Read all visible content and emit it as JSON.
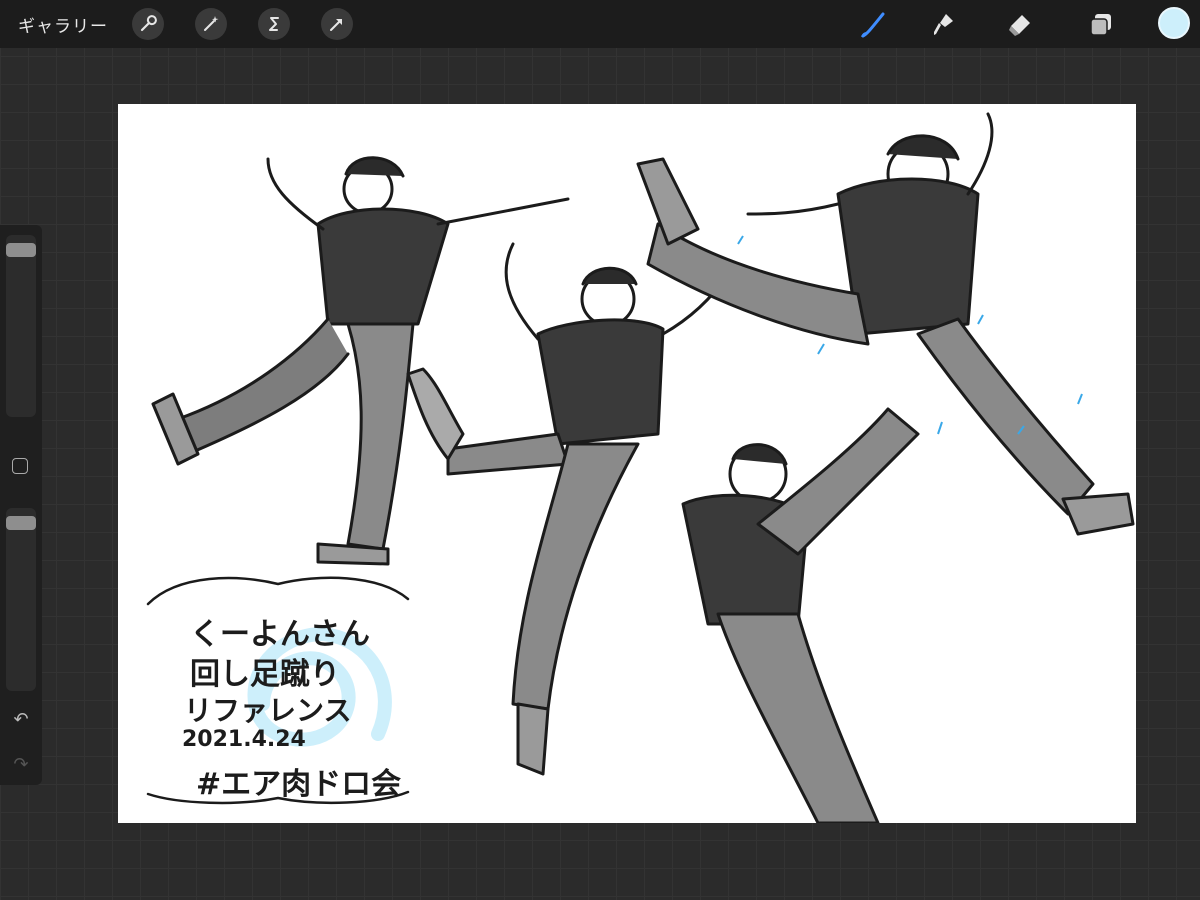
{
  "topbar": {
    "gallery_label": "ギャラリー",
    "tools_left": [
      "wrench-icon",
      "magic-wand-icon",
      "selection-icon",
      "transform-arrow-icon"
    ],
    "tools_right": [
      "brush-icon",
      "smudge-icon",
      "eraser-icon",
      "layers-icon"
    ],
    "active_tool": "brush-icon",
    "active_color": "#cdeffb",
    "accent_color": "#3f8dff"
  },
  "sidebar": {
    "brush_size_level": 0.05,
    "opacity_level": 0.05,
    "undo_icon": "undo-icon",
    "redo_icon": "redo-icon"
  },
  "canvas": {
    "caption": {
      "line1": "くーよんさん",
      "line2": "回し足蹴り",
      "line3": "リファレンス",
      "date": "2021.4.24",
      "tag": "#エア肉ドロ会"
    }
  }
}
